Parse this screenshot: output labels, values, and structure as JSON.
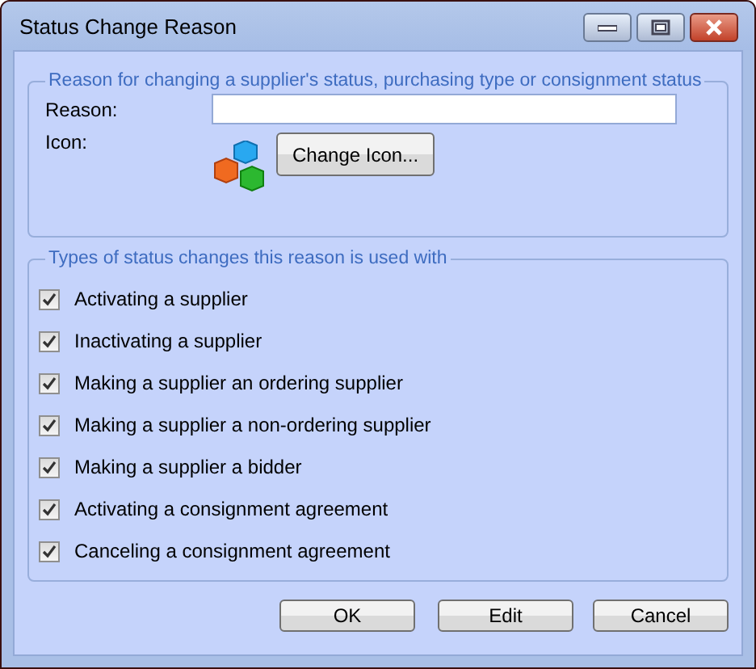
{
  "window": {
    "title": "Status Change Reason"
  },
  "reason_group": {
    "legend": "Reason for changing a supplier's status, purchasing type or consignment status",
    "reason_label": "Reason:",
    "icon_label": "Icon:",
    "change_icon_button": "Change Icon..."
  },
  "types_group": {
    "legend": "Types of status changes this reason is used with",
    "items": [
      {
        "label": "Activating a supplier",
        "checked": true
      },
      {
        "label": "Inactivating a supplier",
        "checked": true
      },
      {
        "label": "Making a supplier an ordering supplier",
        "checked": true
      },
      {
        "label": "Making a supplier a non-ordering supplier",
        "checked": true
      },
      {
        "label": "Making a supplier a bidder",
        "checked": true
      },
      {
        "label": "Activating a consignment agreement",
        "checked": true
      },
      {
        "label": "Canceling a consignment agreement",
        "checked": true
      }
    ]
  },
  "buttons": [
    "OK",
    "Edit",
    "Cancel"
  ]
}
